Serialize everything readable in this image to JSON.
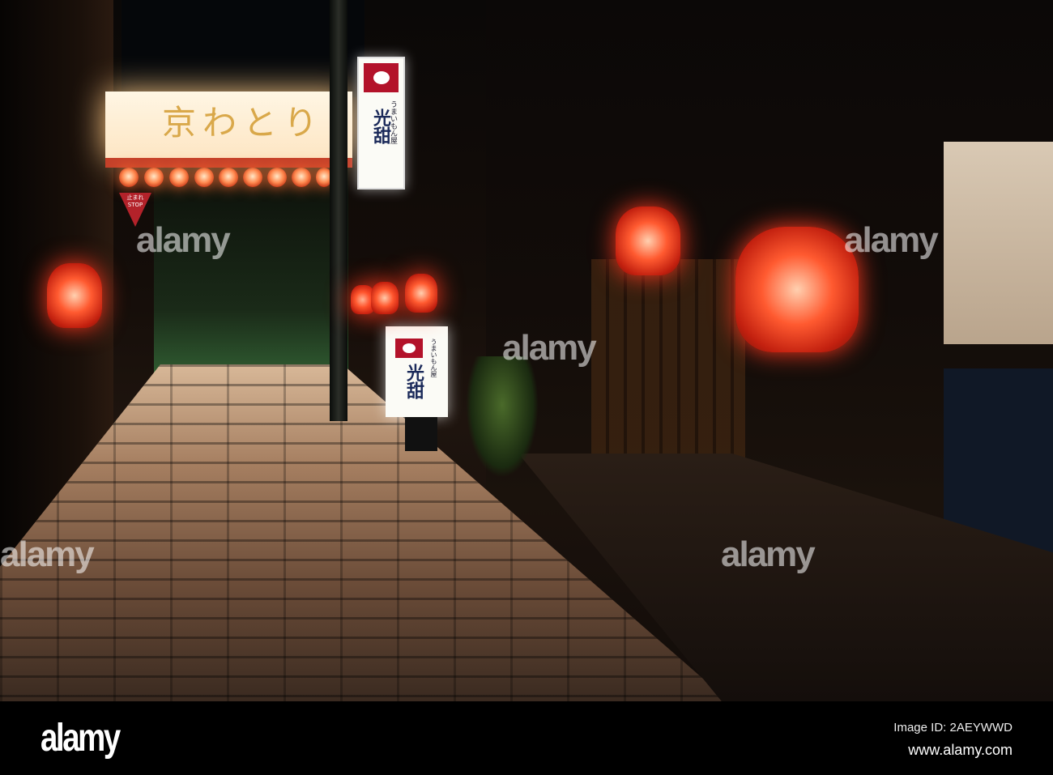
{
  "scene": {
    "banner_text": "京わとり",
    "hanging_sign": {
      "small_text": "うまいもん屋",
      "name": "光甜"
    },
    "a_frame_sign": {
      "small_text": "うまいもん屋",
      "name": "光甜"
    },
    "stop_sign": {
      "jp": "止まれ",
      "en": "STOP"
    }
  },
  "watermark": {
    "text": "alamy",
    "small_text": "a"
  },
  "footer": {
    "logo": "alamy",
    "image_id": "Image ID: 2AEYWWD",
    "website": "www.alamy.com"
  },
  "colors": {
    "lantern_red": "#e03a1a",
    "sign_crest": "#b3122a"
  }
}
